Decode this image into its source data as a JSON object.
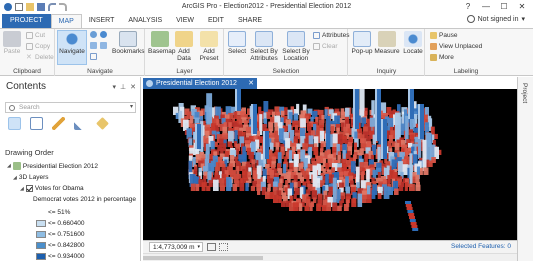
{
  "window": {
    "title": "ArcGIS Pro - Election2012 - Presidential Election 2012",
    "help": "?",
    "minimize": "—",
    "maximize": "☐",
    "close": "✕"
  },
  "ribbon_tabs": [
    "PROJECT",
    "MAP",
    "INSERT",
    "ANALYSIS",
    "VIEW",
    "EDIT",
    "SHARE"
  ],
  "active_tab": "MAP",
  "account": {
    "label": "Not signed in",
    "caret": "▾"
  },
  "ribbon": {
    "clipboard": {
      "paste": "Paste",
      "cut": "Cut",
      "copy": "Copy",
      "delete": "Delete",
      "label": "Clipboard"
    },
    "navigate": {
      "navigate": "Navigate",
      "bookmarks": "Bookmarks",
      "label": "Navigate"
    },
    "layer": {
      "basemap": "Basemap",
      "add_data": "Add Data",
      "add_preset": "Add Preset",
      "label": "Layer"
    },
    "selection": {
      "select": "Select",
      "select_by_attributes": "Select By Attributes",
      "select_by_location": "Select By Location",
      "attributes": "Attributes",
      "clear": "Clear",
      "label": "Selection"
    },
    "inquiry": {
      "popup": "Pop-up",
      "measure": "Measure",
      "locate": "Locate",
      "label": "Inquiry"
    },
    "labeling": {
      "pause": "Pause",
      "view_unplaced": "View Unplaced",
      "more": "More",
      "label": "Labeling"
    }
  },
  "contents": {
    "title": "Contents",
    "search_placeholder": "Search",
    "section": "Drawing Order",
    "map_name": "Presidential Election 2012",
    "group": "3D Layers",
    "layer": "Votes for Obama",
    "field": "Democrat votes 2012 in percentage",
    "legend": [
      {
        "label": "<= 51%",
        "color": "#ffffff"
      },
      {
        "label": "<= 0.660400",
        "color": "#c9dff1"
      },
      {
        "label": "<= 0.751600",
        "color": "#8fbde3"
      },
      {
        "label": "<= 0.842800",
        "color": "#4b8fcb"
      },
      {
        "label": "<= 0.934000",
        "color": "#1d5fae"
      }
    ]
  },
  "map_tab": {
    "title": "Presidential Election 2012",
    "close": "✕"
  },
  "status": {
    "scale": "1:4,773,009 m",
    "selected_features": "Selected Features: 0"
  },
  "right_panel": {
    "tab": "Project"
  },
  "colors": {
    "accent": "#2d6ab3",
    "rep_red": "#c9382c",
    "dem_blue": "#2f6db7",
    "map_bg": "#000000"
  }
}
